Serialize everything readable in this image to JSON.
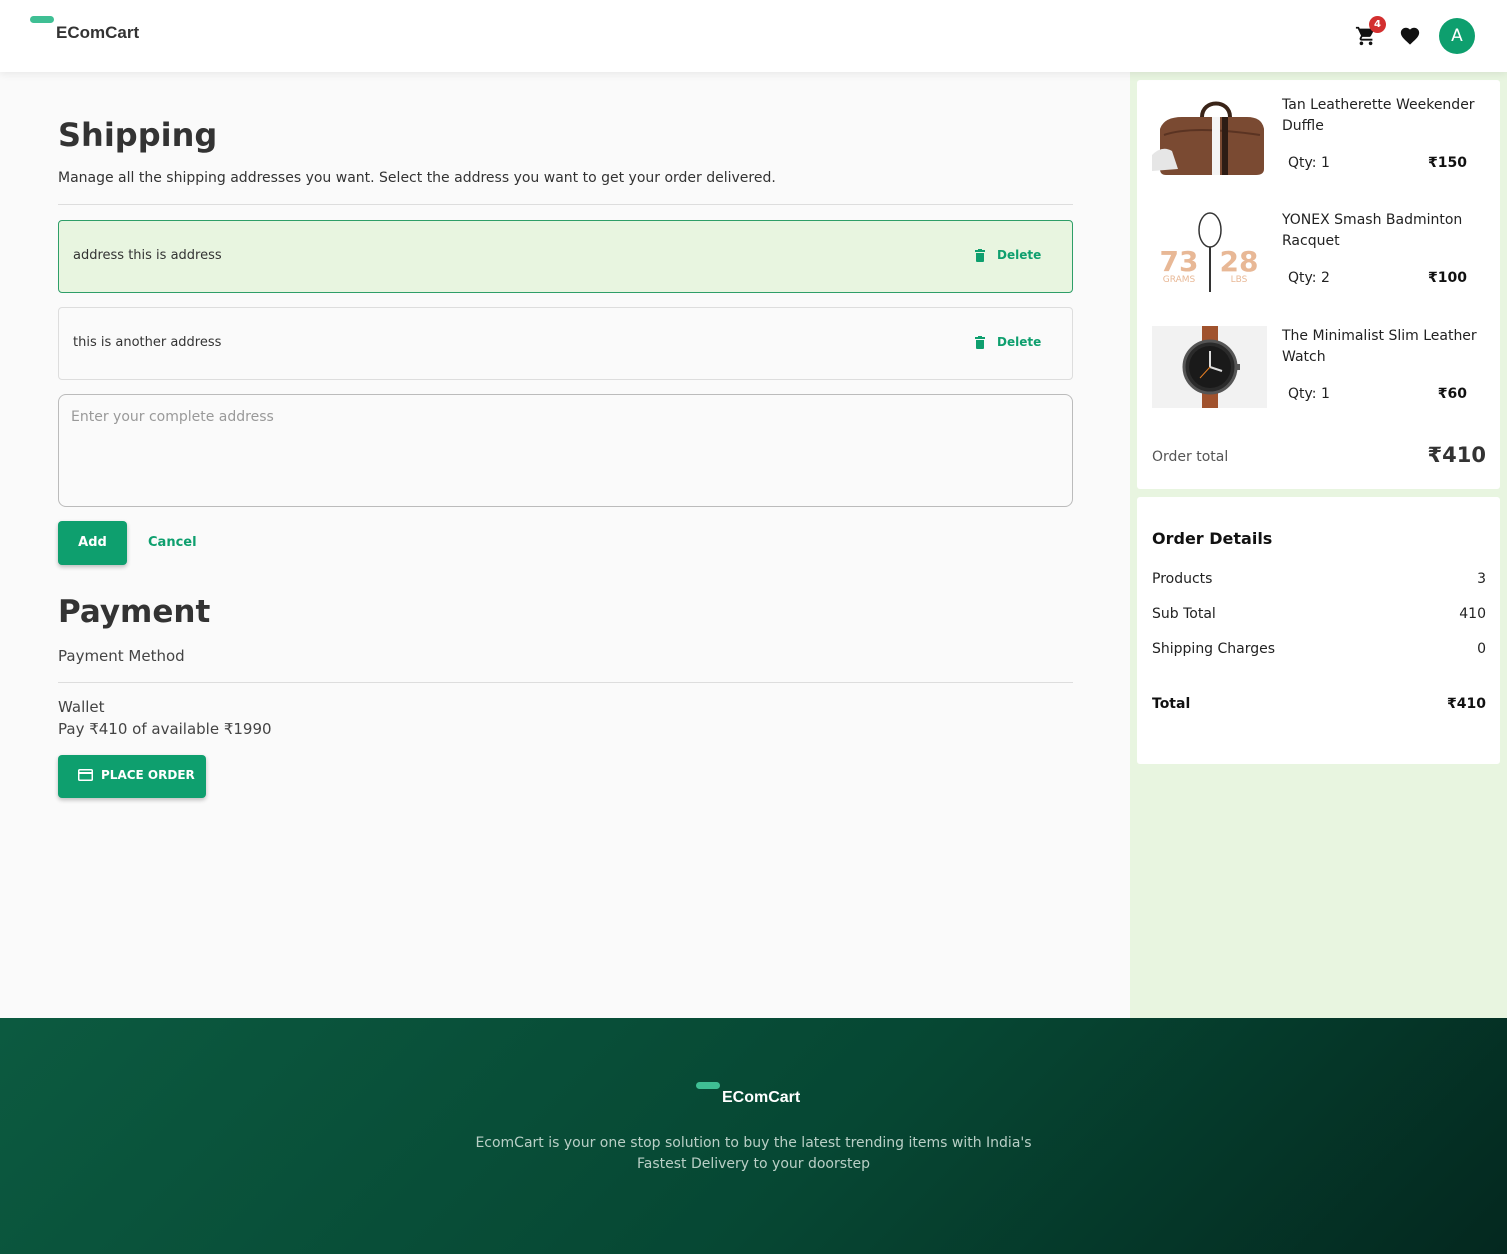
{
  "header": {
    "logo_text": "EComCart",
    "cart_count": "4",
    "avatar_initial": "A"
  },
  "shipping": {
    "title": "Shipping",
    "description": "Manage all the shipping addresses you want. Select the address you want to get your order delivered.",
    "addresses": [
      {
        "text": "address this is address",
        "selected": true,
        "delete_label": "Delete"
      },
      {
        "text": "this is another address",
        "selected": false,
        "delete_label": "Delete"
      }
    ],
    "input_placeholder": "Enter your complete address",
    "add_label": "Add",
    "cancel_label": "Cancel"
  },
  "payment": {
    "title": "Payment",
    "method_label": "Payment Method",
    "wallet_label": "Wallet",
    "pay_text": "Pay ₹410 of available ₹1990",
    "place_order_label": "PLACE ORDER"
  },
  "cart": {
    "items": [
      {
        "name": "Tan Leatherette Weekender Duffle",
        "qty": "Qty: 1",
        "price": "₹150",
        "thumb_icon": "duffle-bag-image"
      },
      {
        "name": "YONEX Smash Badminton Racquet",
        "qty": "Qty: 2",
        "price": "₹100",
        "thumb_icon": "badminton-racquet-image",
        "thumb_text": {
          "grams": "73",
          "grams_unit": "GRAMS",
          "lbs": "28",
          "lbs_unit": "LBS"
        }
      },
      {
        "name": "The Minimalist Slim Leather Watch",
        "qty": "Qty: 1",
        "price": "₹60",
        "thumb_icon": "watch-image"
      }
    ],
    "order_total_label": "Order total",
    "order_total_value": "₹410"
  },
  "order_details": {
    "title": "Order Details",
    "rows": [
      {
        "label": "Products",
        "value": "3"
      },
      {
        "label": "Sub Total",
        "value": "410"
      },
      {
        "label": "Shipping Charges",
        "value": "0"
      }
    ],
    "total_label": "Total",
    "total_value": "₹410"
  },
  "footer": {
    "logo_text": "EComCart",
    "tagline": "EcomCart is your one stop solution to buy the latest trending items with India's Fastest Delivery to your doorstep"
  },
  "colors": {
    "accent": "#0e9f6e",
    "logo_bar": "#3fbf94",
    "selected_bg": "#e8f5e0",
    "sidebar_bg": "#e8f5e0",
    "badge": "#d32f2f",
    "footer_dark": "#064733"
  }
}
